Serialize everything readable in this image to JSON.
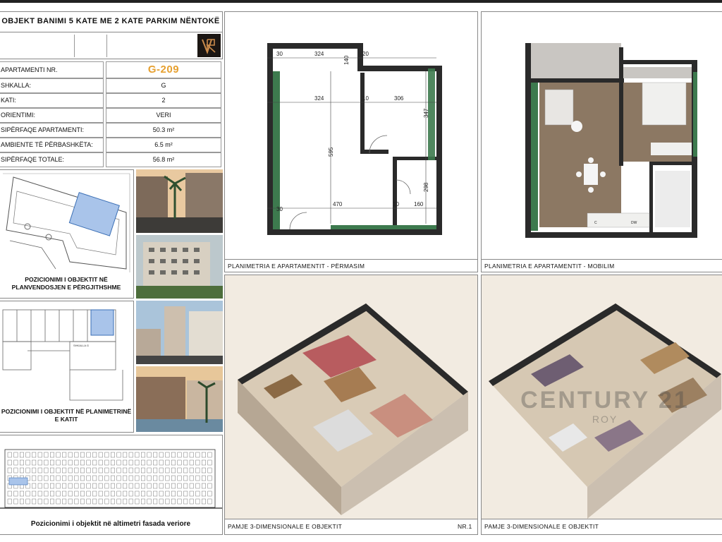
{
  "header": {
    "title": "OBJEKT BANIMI 5 KATE ME 2 KATE PARKIM NËNTOKË",
    "company_text_left": "",
    "company_text_right": ""
  },
  "info_table": {
    "rows": [
      {
        "label": "APARTAMENTI NR.",
        "value": "G-209"
      },
      {
        "label": "SHKALLA:",
        "value": "G"
      },
      {
        "label": "KATI:",
        "value": "2"
      },
      {
        "label": "ORIENTIMI:",
        "value": "VERI"
      },
      {
        "label": "SIPËRFAQE APARTAMENTI:",
        "value": "50.3 m²"
      },
      {
        "label": "AMBIENTE TË PËRBASHKËTA:",
        "value": "6.5 m²"
      },
      {
        "label": "SIPËRFAQE TOTALE:",
        "value": "56.8 m²"
      }
    ]
  },
  "left_panels": {
    "site_plan_caption": "POZICIONIMI I OBJEKTIT NË PLANVENDOSJEN E PËRGJITHSHME",
    "floor_plan_caption": "POZICIONIMI I OBJEKTIT NË PLANIMETRINË E KATIT",
    "floor_plan_label": "SHKALLA G",
    "facade_caption": "Pozicionimi i objektit në altimetri fasada veriore"
  },
  "plan_dimensions": {
    "caption": "PLANIMETRIA E APARTAMENTIT - PËRMASIM",
    "labels": [
      "324",
      "324",
      "306",
      "470",
      "160",
      "595",
      "347",
      "298",
      "140",
      "30",
      "20",
      "10"
    ]
  },
  "plan_furnished": {
    "caption": "PLANIMETRIA E APARTAMENTIT - MOBILIM",
    "labels": [
      "DW",
      "C"
    ]
  },
  "views": [
    {
      "caption": "PAMJE 3-DIMENSIONALE E OBJEKTIT",
      "number": "NR.1"
    },
    {
      "caption": "PAMJE 3-DIMENSIONALE E OBJEKTIT",
      "number": ""
    }
  ],
  "watermark": {
    "text": "CENTURY 21",
    "sub": "ROY"
  },
  "colors": {
    "accent": "#e6a030",
    "wall": "#2a2a2a",
    "green": "#3d7a4e",
    "floor": "#8c7863",
    "blue": "#a9c4ea"
  }
}
